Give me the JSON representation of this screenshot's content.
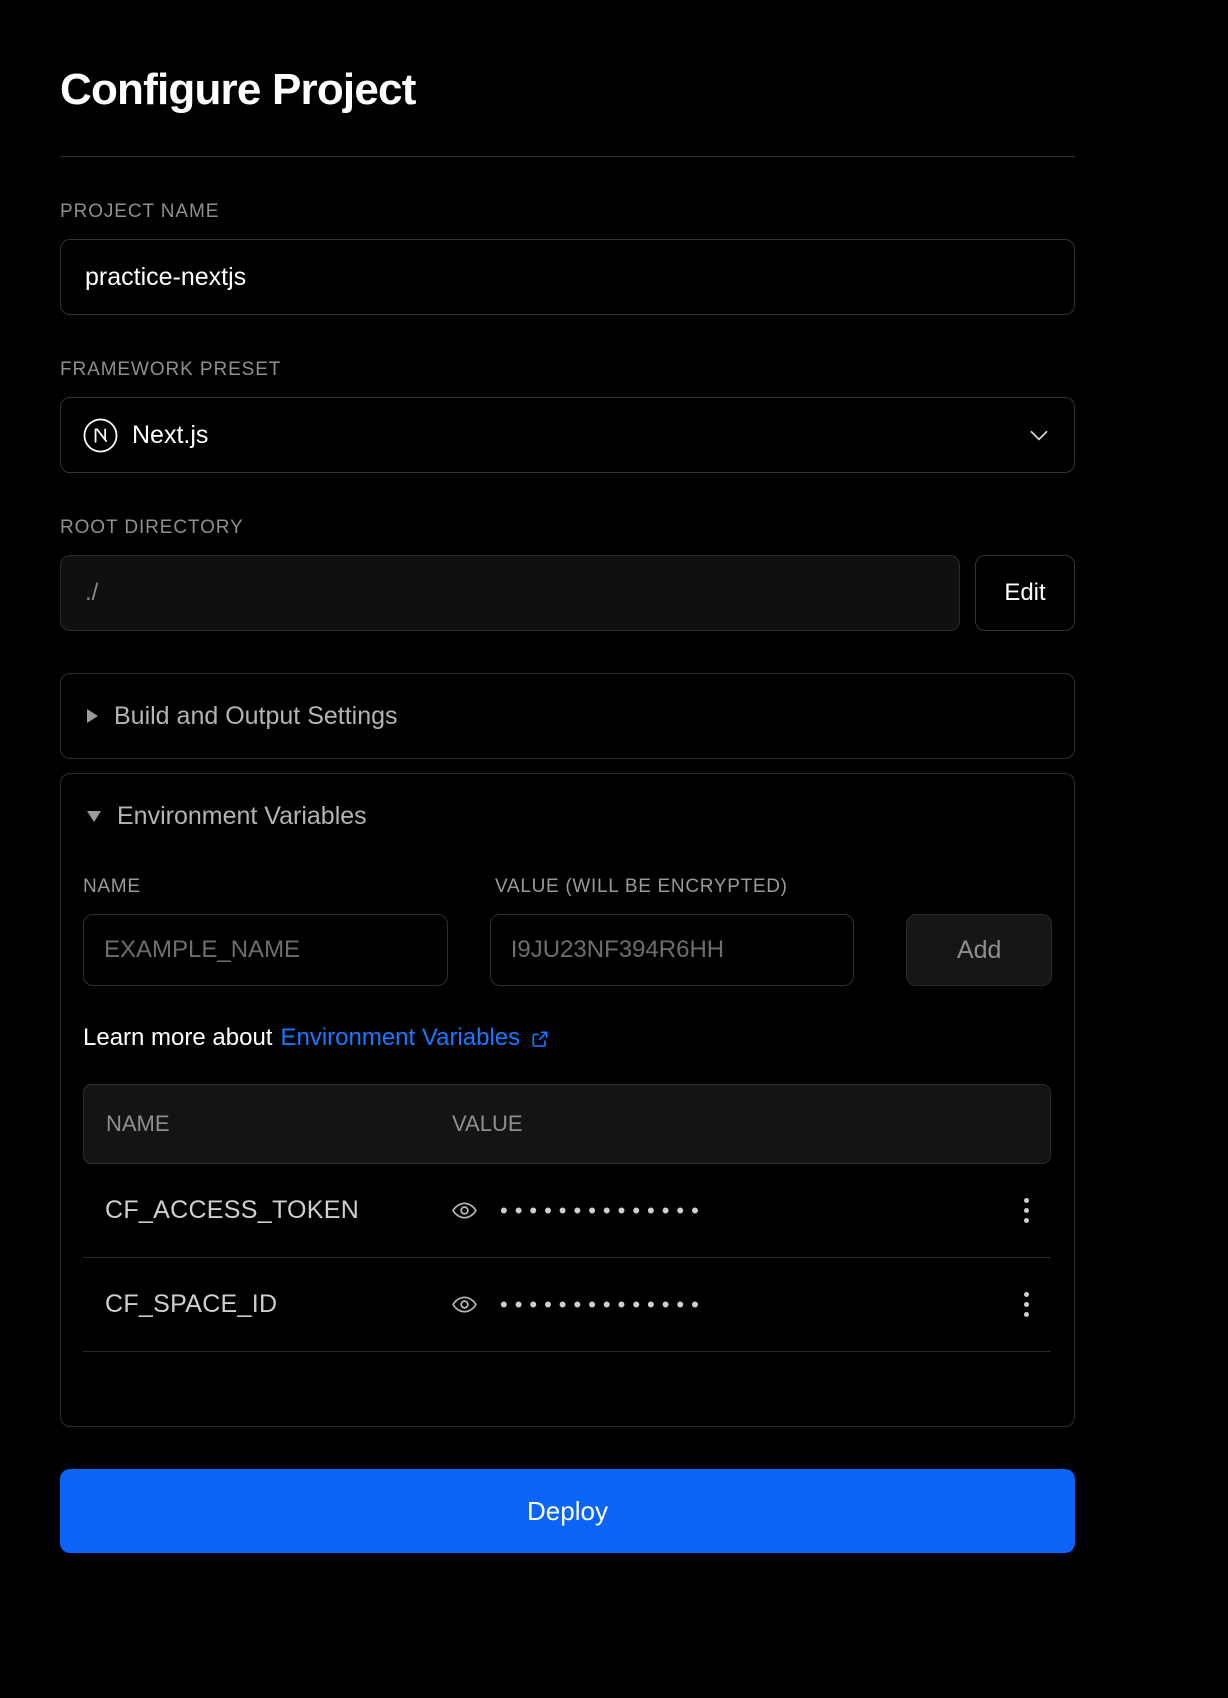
{
  "header": {
    "title": "Configure Project"
  },
  "project_name": {
    "label": "PROJECT NAME",
    "value": "practice-nextjs"
  },
  "framework_preset": {
    "label": "FRAMEWORK PRESET",
    "value": "Next.js",
    "logo_icon": "nextjs-logo-icon",
    "chevron_icon": "chevron-down-icon"
  },
  "root_directory": {
    "label": "ROOT DIRECTORY",
    "value": "./",
    "edit_label": "Edit"
  },
  "build_output": {
    "title": "Build and Output Settings",
    "expanded": false,
    "toggle_icon": "triangle-right-icon"
  },
  "environment_variables": {
    "title": "Environment Variables",
    "expanded": true,
    "toggle_icon": "triangle-down-icon",
    "form": {
      "name_header": "NAME",
      "value_header": "VALUE (WILL BE ENCRYPTED)",
      "name_placeholder": "EXAMPLE_NAME",
      "value_placeholder": "I9JU23NF394R6HH",
      "add_label": "Add"
    },
    "learn_more": {
      "prefix": "Learn more about",
      "link_text": "Environment Variables",
      "external_icon": "external-link-icon"
    },
    "table": {
      "columns": [
        "NAME",
        "VALUE"
      ],
      "rows": [
        {
          "name": "CF_ACCESS_TOKEN",
          "masked_value": "••••••••••••••",
          "eye_icon": "eye-icon",
          "menu_icon": "kebab-menu-icon"
        },
        {
          "name": "CF_SPACE_ID",
          "masked_value": "••••••••••••••",
          "eye_icon": "eye-icon",
          "menu_icon": "kebab-menu-icon"
        }
      ]
    }
  },
  "deploy": {
    "label": "Deploy",
    "color": "#0a65f7"
  }
}
